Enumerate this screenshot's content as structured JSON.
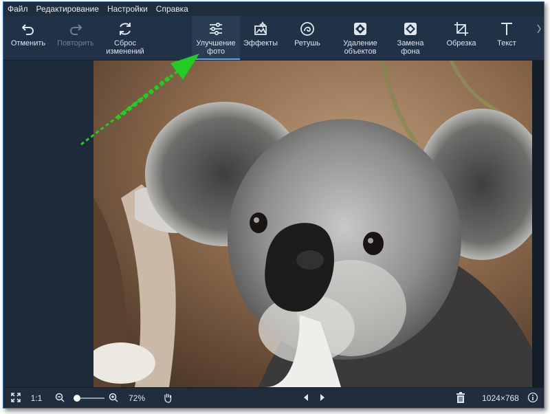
{
  "menu": [
    "Файл",
    "Редактирование",
    "Настройки",
    "Справка"
  ],
  "toolbar": {
    "undo": "Отменить",
    "redo": "Повторить",
    "reset": "Сброс\nизменений",
    "enhance": "Улучшение\nфото",
    "effects": "Эффекты",
    "retouch": "Ретушь",
    "remove_objects": "Удаление\nобъектов",
    "replace_bg": "Замена\nфона",
    "crop": "Обрезка",
    "text": "Текст"
  },
  "statusbar": {
    "ratio": "1:1",
    "zoom": "72%",
    "zoom_level": 0.72,
    "dimensions": "1024×768"
  },
  "colors": {
    "accent": "#55a8ff",
    "annotation_arrow": "#22cc22"
  }
}
